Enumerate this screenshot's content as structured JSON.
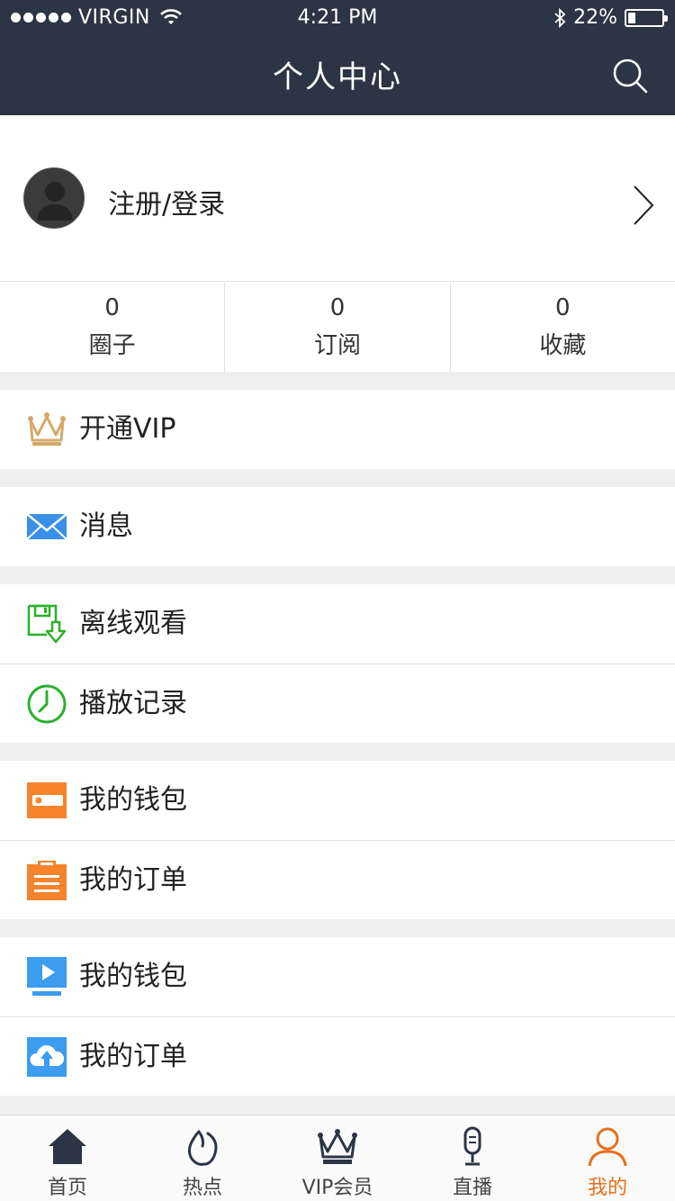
{
  "status_bar": {
    "carrier": "VIRGIN",
    "time": "4:21 PM",
    "battery": "22%",
    "battery_level": 0.22
  },
  "nav": {
    "title": "个人中心",
    "search_icon": "search-icon"
  },
  "profile": {
    "login_label": "注册/登录",
    "avatar_icon": "default-avatar-icon",
    "chevron_icon": "chevron-right-icon"
  },
  "stats": [
    {
      "value": "0",
      "label": "圈子"
    },
    {
      "value": "0",
      "label": "订阅"
    },
    {
      "value": "0",
      "label": "收藏"
    }
  ],
  "menu": [
    {
      "label": "开通VIP",
      "icon": "crown-icon",
      "color": "#d4a96a"
    },
    {
      "label": "消息",
      "icon": "envelope-icon",
      "color": "#3b8fe8"
    },
    {
      "label": "离线观看",
      "icon": "download-save-icon",
      "color": "#2bb02b"
    },
    {
      "label": "播放记录",
      "icon": "clock-icon",
      "color": "#2bb02b"
    },
    {
      "label": "我的钱包",
      "icon": "wallet-icon",
      "color": "#f5842d"
    },
    {
      "label": "我的订单",
      "icon": "clipboard-icon",
      "color": "#f5842d"
    },
    {
      "label": "我的钱包",
      "icon": "video-screen-icon",
      "color": "#3b9cf0"
    },
    {
      "label": "我的订单",
      "icon": "cloud-upload-icon",
      "color": "#3b9cf0"
    }
  ],
  "tabs": [
    {
      "label": "首页",
      "icon": "home-icon",
      "active": false
    },
    {
      "label": "热点",
      "icon": "flame-icon",
      "active": false
    },
    {
      "label": "VIP会员",
      "icon": "crown-icon",
      "active": false
    },
    {
      "label": "直播",
      "icon": "microphone-icon",
      "active": false
    },
    {
      "label": "我的",
      "icon": "person-icon",
      "active": true
    }
  ],
  "colors": {
    "nav_bg": "#2c3545",
    "accent": "#e8701a",
    "page_bg": "#efefef"
  }
}
